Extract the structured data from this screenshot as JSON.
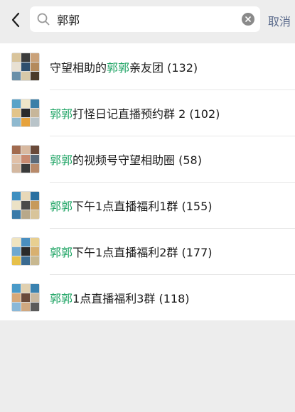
{
  "search": {
    "query": "郭郭",
    "cancel_label": "取消"
  },
  "results": [
    {
      "pre": "守望相助的",
      "hl": "郭郭",
      "post": "亲友团 (132)",
      "tiles": [
        "#d9c49b",
        "#3c3c3c",
        "#caa27a",
        "#e8e0d2",
        "#2f4f6e",
        "#b48a5c",
        "#6a8fa8",
        "#d8c9a8",
        "#4a3a2a"
      ]
    },
    {
      "pre": "",
      "hl": "郭郭",
      "post": "打怪日记直播预约群 2 (102)",
      "tiles": [
        "#5aa3c8",
        "#f0e6c8",
        "#3b7fa8",
        "#e2c48a",
        "#2a2a2a",
        "#c7b69a",
        "#8fb9cf",
        "#e6a23c",
        "#b9c4c9"
      ]
    },
    {
      "pre": "",
      "hl": "郭郭",
      "post": "的视频号守望相助圈 (58)",
      "tiles": [
        "#a26b4f",
        "#d8b9a0",
        "#6a4a3a",
        "#e0c0a8",
        "#c98a70",
        "#5a6a7a",
        "#d4b8a0",
        "#3a3a3a",
        "#b88a6a"
      ]
    },
    {
      "pre": "",
      "hl": "郭郭",
      "post": "下午1点直播福利1群 (155)",
      "tiles": [
        "#3f8fc0",
        "#e8d8b8",
        "#2a6fa0",
        "#ece2c6",
        "#4a4a4a",
        "#c79a5a",
        "#3a7aa8",
        "#b8a88a",
        "#d8c49a"
      ]
    },
    {
      "pre": "",
      "hl": "郭郭",
      "post": "下午1点直播福利2群 (177)",
      "tiles": [
        "#f0e4c0",
        "#4a8fc0",
        "#e8cf90",
        "#6fa8d0",
        "#2a2a2a",
        "#d8b070",
        "#e6c04a",
        "#3a6a90",
        "#c8b890"
      ]
    },
    {
      "pre": "",
      "hl": "郭郭",
      "post": "1点直播福利3群 (118)",
      "tiles": [
        "#4a9ac8",
        "#e0d0b0",
        "#3a82b0",
        "#d8a878",
        "#6a4a3a",
        "#c8b8a0",
        "#8ab8d8",
        "#d0a880",
        "#5a5a5a"
      ]
    }
  ]
}
